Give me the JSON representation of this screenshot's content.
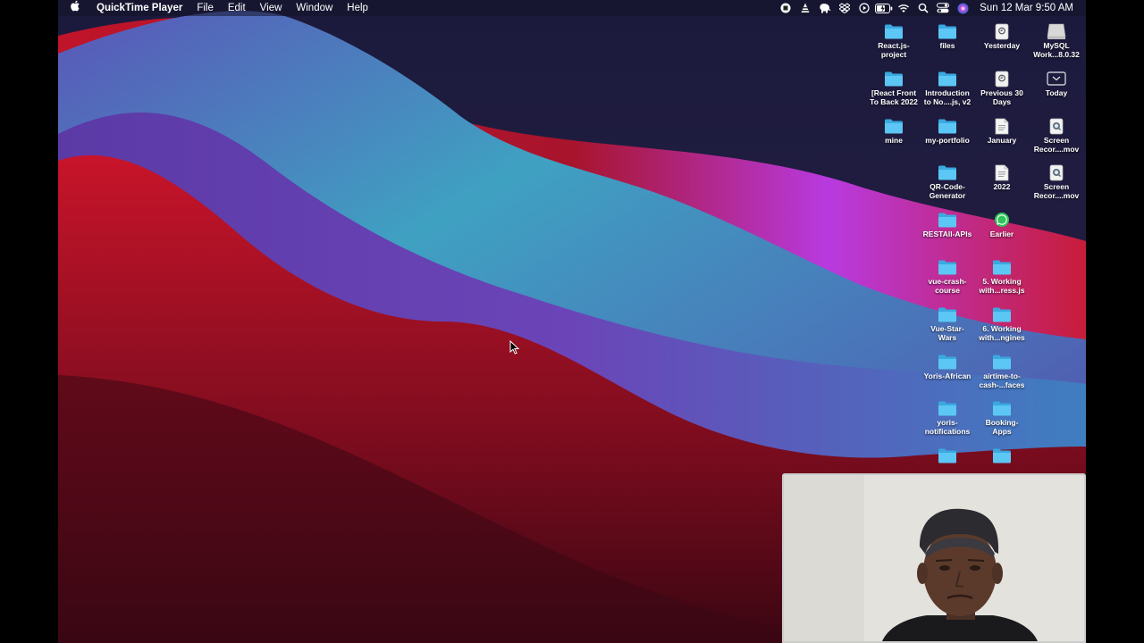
{
  "menubar": {
    "apple_icon": "apple-icon",
    "app_name": "QuickTime Player",
    "menus": [
      "File",
      "Edit",
      "View",
      "Window",
      "Help"
    ],
    "status_icons": [
      "record-stop-icon",
      "vlc-icon",
      "elephant-icon",
      "dropbox-icon",
      "play-circle-icon",
      "battery-icon",
      "wifi-icon",
      "search-icon",
      "control-center-icon",
      "siri-icon"
    ],
    "clock": "Sun 12 Mar  9:50 AM"
  },
  "desktop": {
    "icons": [
      {
        "label": "React.js-\nproject",
        "type": "folder"
      },
      {
        "label": "files",
        "type": "folder"
      },
      {
        "label": "Yesterday",
        "type": "smart-doc"
      },
      {
        "label": "MySQL\nWork...8.0.32",
        "type": "disk"
      },
      {
        "label": "[React Front\nTo Back 2022",
        "type": "folder"
      },
      {
        "label": "Introduction\nto No....js, v2",
        "type": "folder"
      },
      {
        "label": "Previous 30\nDays",
        "type": "smart-doc"
      },
      {
        "label": "Today",
        "type": "screen"
      },
      {
        "label": "mine",
        "type": "folder"
      },
      {
        "label": "my-portfolio",
        "type": "folder"
      },
      {
        "label": "January",
        "type": "doc"
      },
      {
        "label": "Screen\nRecor....mov",
        "type": "movie"
      },
      {
        "label": "QR-Code-\nGenerator",
        "type": "folder"
      },
      {
        "label": "2022",
        "type": "doc"
      },
      {
        "label": "Screen\nRecor....mov",
        "type": "movie"
      },
      {
        "label": "RESTAll-APIs",
        "type": "folder"
      },
      {
        "label": "Earlier",
        "type": "whatsapp"
      },
      {
        "label": "vue-crash-\ncourse",
        "type": "folder"
      },
      {
        "label": "5. Working\nwith...ress.js",
        "type": "folder"
      },
      {
        "label": "Vue-Star-\nWars",
        "type": "folder"
      },
      {
        "label": "6. Working\nwith...ngines",
        "type": "folder"
      },
      {
        "label": "Yoris-African",
        "type": "folder"
      },
      {
        "label": "airtime-to-\ncash-...faces",
        "type": "folder"
      },
      {
        "label": "yoris-\nnotifications",
        "type": "folder"
      },
      {
        "label": "Booking-\nApps",
        "type": "folder"
      },
      {
        "label": "",
        "type": "folder"
      },
      {
        "label": "",
        "type": "folder"
      }
    ]
  },
  "colors": {
    "folder": "#4fc3f7",
    "wall_dark": "#1c1a3a",
    "wall_teal": "#3f9fbf",
    "wall_purple": "#6a3fa0",
    "wall_red": "#c8142a",
    "wall_magenta": "#b03be0"
  }
}
